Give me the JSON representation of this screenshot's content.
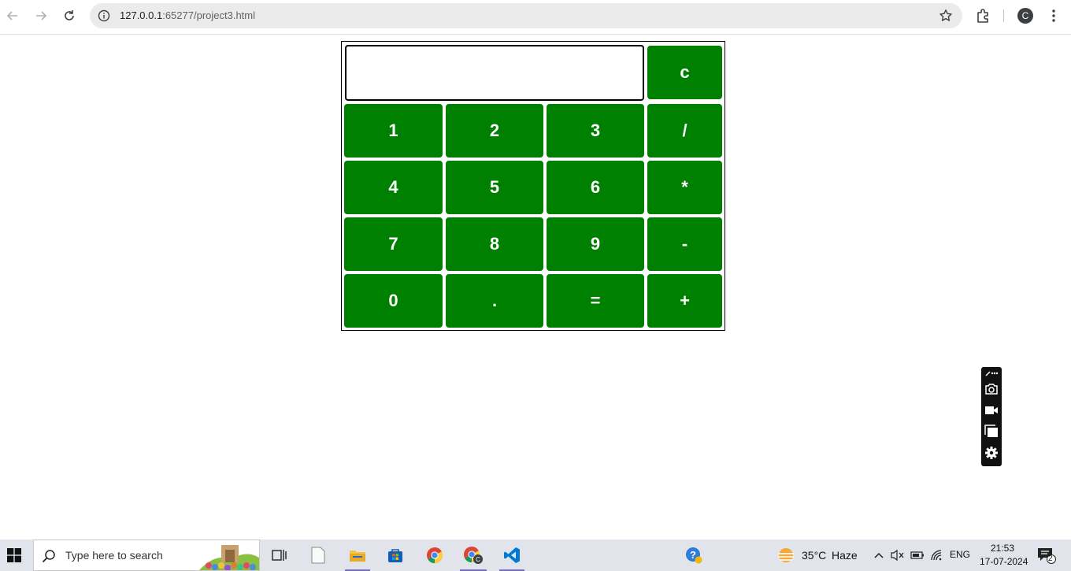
{
  "browser": {
    "url_host": "127.0.0.1",
    "url_path": ":65277/project3.html",
    "profile_initial": "C"
  },
  "calculator": {
    "display_value": "",
    "clear_label": "c",
    "keys": [
      "1",
      "2",
      "3",
      "/",
      "4",
      "5",
      "6",
      "*",
      "7",
      "8",
      "9",
      "-",
      "0",
      ".",
      "=",
      "+"
    ],
    "key_color": "#008000"
  },
  "taskbar": {
    "search_placeholder": "Type here to search",
    "weather_temp": "35°C",
    "weather_desc": "Haze",
    "language": "ENG",
    "time": "21:53",
    "date": "17-07-2024",
    "notification_count": "2"
  }
}
